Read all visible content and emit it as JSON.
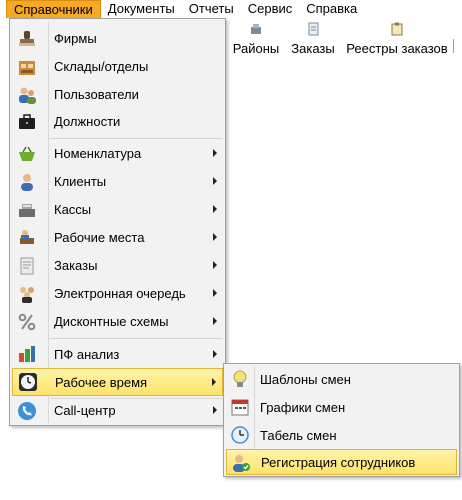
{
  "menubar": {
    "items": [
      {
        "label": "Справочники"
      },
      {
        "label": "Документы"
      },
      {
        "label": "Отчеты"
      },
      {
        "label": "Сервис"
      },
      {
        "label": "Справка"
      }
    ]
  },
  "toolbar": {
    "buttons": [
      {
        "label": "Районы",
        "icon": "districts-icon"
      },
      {
        "label": "Заказы",
        "icon": "orders-icon"
      },
      {
        "label": "Реестры заказов",
        "icon": "order-registers-icon"
      }
    ]
  },
  "menu": {
    "items": [
      {
        "label": "Фирмы",
        "icon": "stamp-icon"
      },
      {
        "label": "Склады/отделы",
        "icon": "warehouse-icon"
      },
      {
        "label": "Пользователи",
        "icon": "users-icon"
      },
      {
        "label": "Должности",
        "icon": "briefcase-icon"
      },
      {
        "label": "Номенклатура",
        "icon": "basket-icon"
      },
      {
        "label": "Клиенты",
        "icon": "client-icon"
      },
      {
        "label": "Кассы",
        "icon": "cash-register-icon"
      },
      {
        "label": "Рабочие места",
        "icon": "workplace-icon"
      },
      {
        "label": "Заказы",
        "icon": "document-icon"
      },
      {
        "label": "Электронная очередь",
        "icon": "queue-icon"
      },
      {
        "label": "Дисконтные схемы",
        "icon": "percent-icon"
      },
      {
        "label": "ПФ анализ",
        "icon": "analysis-icon"
      },
      {
        "label": "Рабочее время",
        "icon": "clock-icon"
      },
      {
        "label": "Call-центр",
        "icon": "phone-icon"
      }
    ]
  },
  "submenu": {
    "items": [
      {
        "label": "Шаблоны смен",
        "icon": "lightbulb-icon"
      },
      {
        "label": "Графики смен",
        "icon": "calendar-icon"
      },
      {
        "label": "Табель смен",
        "icon": "timesheet-icon"
      },
      {
        "label": "Регистрация сотрудников",
        "icon": "employee-check-icon"
      }
    ]
  },
  "colors": {
    "active_menu": "#f7a824",
    "highlight_top": "#fff3a8",
    "highlight_bottom": "#fde36a"
  }
}
